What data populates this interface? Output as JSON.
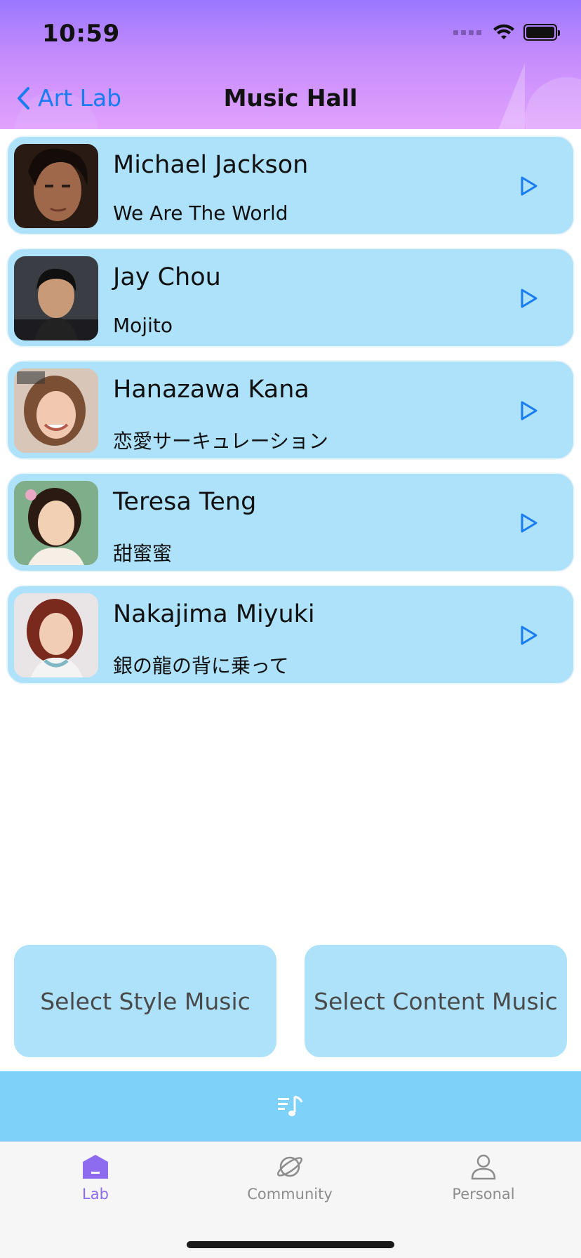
{
  "status": {
    "time": "10:59"
  },
  "nav": {
    "back_label": "Art Lab",
    "title": "Music Hall"
  },
  "tracks": [
    {
      "artist": "Michael Jackson",
      "song": "We Are The World"
    },
    {
      "artist": "Jay Chou",
      "song": "Mojito"
    },
    {
      "artist": "Hanazawa Kana",
      "song": "恋愛サーキュレーション"
    },
    {
      "artist": "Teresa Teng",
      "song": "甜蜜蜜"
    },
    {
      "artist": "Nakajima Miyuki",
      "song": "銀の龍の背に乗って"
    }
  ],
  "buttons": {
    "select_style": "Select Style Music",
    "select_content": "Select Content Music"
  },
  "tabs": [
    {
      "label": "Lab",
      "icon": "home-icon",
      "active": true
    },
    {
      "label": "Community",
      "icon": "planet-icon",
      "active": false
    },
    {
      "label": "Personal",
      "icon": "person-icon",
      "active": false
    }
  ],
  "colors": {
    "accent": "#1a7cf3",
    "card": "#aee2fb",
    "tab_active": "#8e6cf0",
    "player_bar": "#7ed1f9"
  }
}
